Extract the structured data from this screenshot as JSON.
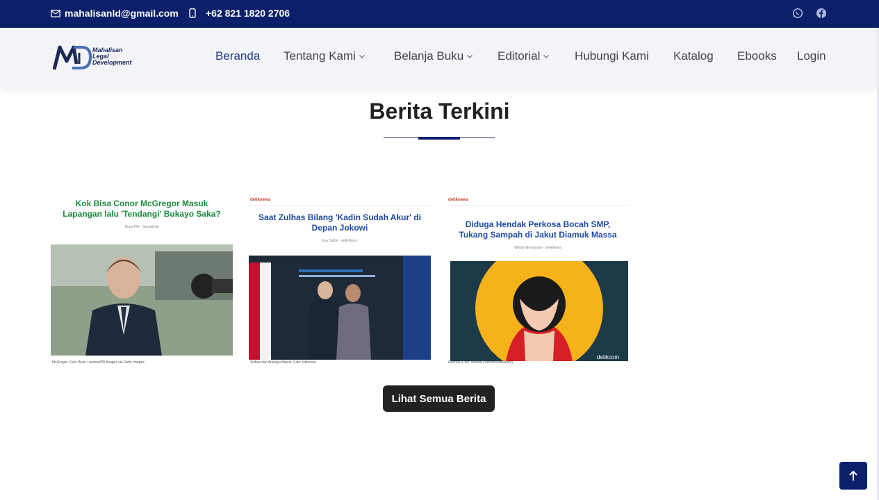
{
  "topbar": {
    "email": "mahalisanld@gmail.com",
    "phone": "+62 821 1820 2706",
    "social": [
      "whatsapp-icon",
      "facebook-icon"
    ]
  },
  "brand": {
    "line1": "Mahalisan",
    "line2": "Legal",
    "line3": "Development"
  },
  "nav": {
    "items": [
      {
        "label": "Beranda",
        "active": true
      },
      {
        "label": "Tentang Kami",
        "dropdown": true
      },
      {
        "label": "Belanja Buku",
        "dropdown": true
      },
      {
        "label": "Editorial",
        "dropdown": true
      },
      {
        "label": "Hubungi Kami"
      },
      {
        "label": "Katalog"
      },
      {
        "label": "Ebooks"
      },
      {
        "label": "Login"
      }
    ]
  },
  "section": {
    "title": "Berita Terkini",
    "button": "Lihat Semua Berita"
  },
  "cards": [
    {
      "headline": "Kok Bisa Conor McGregor Masuk Lapangan lalu 'Tendangi' Bukayo Saka?",
      "byline": "Reza PW · Sepakbola",
      "caption": "McGregor. Foto: Brian Lawless/PA Images via Getty Images"
    },
    {
      "site": "detiknews",
      "headline": "Saat Zulhas Bilang 'Kadin Sudah Akur' di Depan Jokowi",
      "byline": "Eva Safitri · detikNews",
      "caption": "Zulhas dan Anindya Bakrie. Foto: istimewa"
    },
    {
      "site": "detiknews",
      "headline": "Diduga Hendak Perkosa Bocah SMP, Tukang Sampah di Jakut Diamuk Massa",
      "byline": "Wildan Noviansah · detikNews",
      "caption": "Ilustrasi (Foto: Mindra Purnomo/detikcom)",
      "watermark": "detikcom"
    }
  ],
  "colors": {
    "primary": "#0b1f6b",
    "button": "#222222"
  }
}
